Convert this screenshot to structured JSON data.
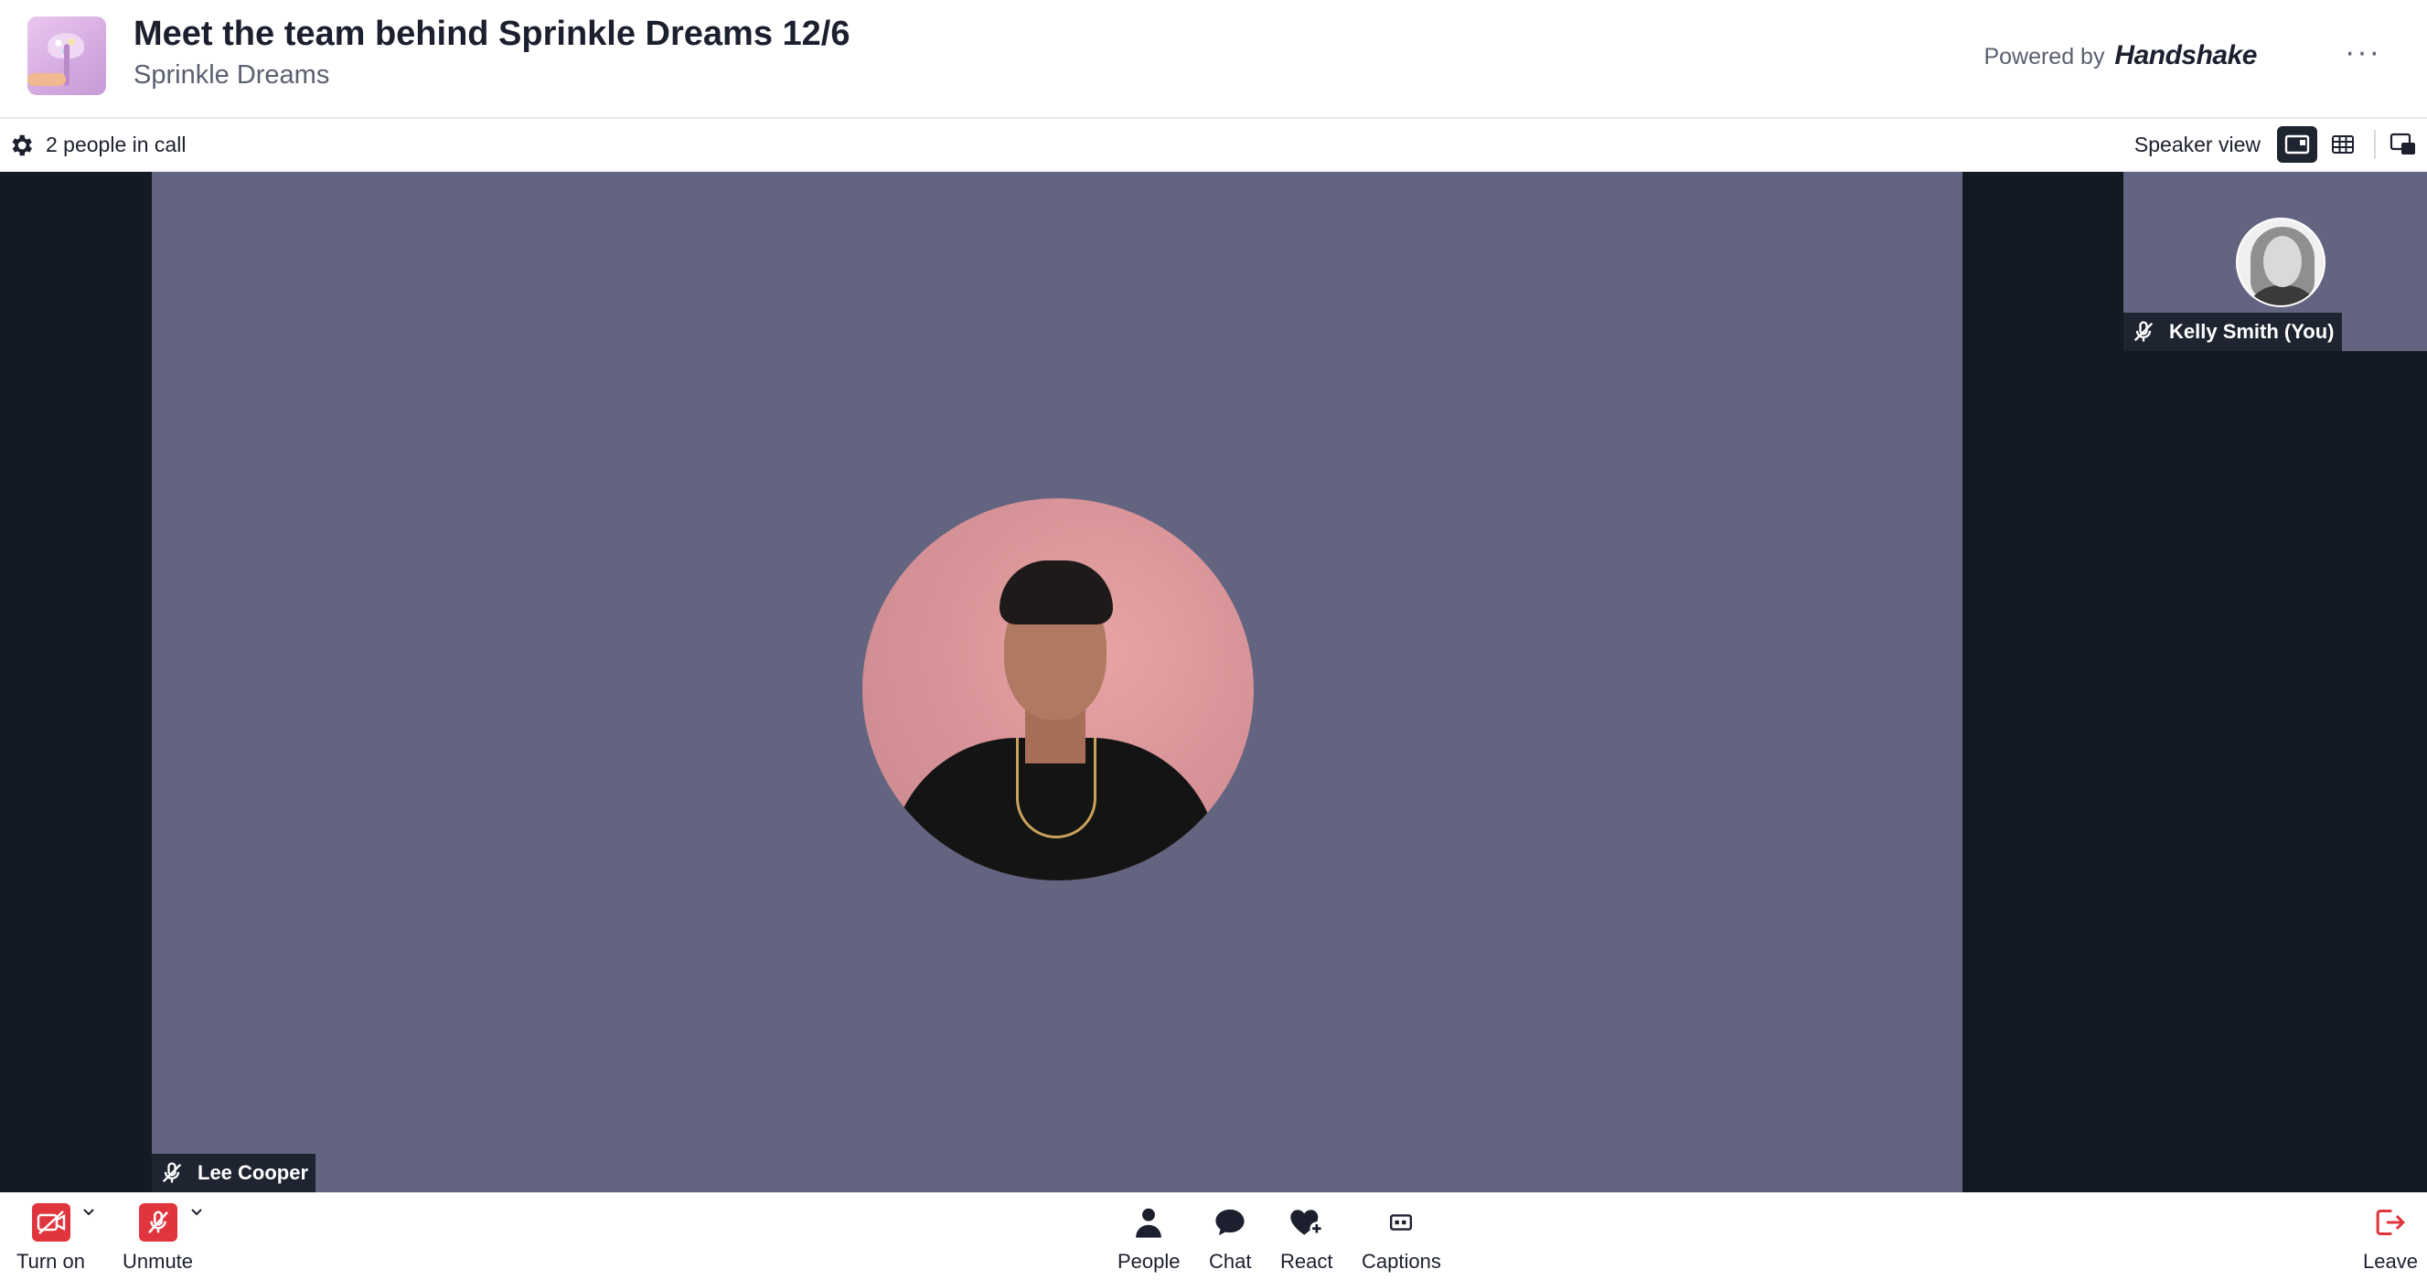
{
  "header": {
    "title": "Meet the team behind Sprinkle Dreams 12/6",
    "organizer": "Sprinkle Dreams",
    "powered_by": "Powered by",
    "brand": "Handshake",
    "more_label": "···"
  },
  "subbar": {
    "people_count": "2 people in call",
    "view_label": "Speaker view"
  },
  "participants": {
    "main": {
      "name": "Lee Cooper",
      "muted": true
    },
    "self": {
      "name": "Kelly Smith (You)",
      "muted": true
    }
  },
  "controls": {
    "camera_label": "Turn on",
    "mic_label": "Unmute",
    "people_label": "People",
    "chat_label": "Chat",
    "react_label": "React",
    "captions_label": "Captions",
    "leave_label": "Leave"
  },
  "colors": {
    "tile_bg": "#626480",
    "stage_bg": "#141a24",
    "danger": "#e0353d",
    "leave": "#e0353d"
  }
}
